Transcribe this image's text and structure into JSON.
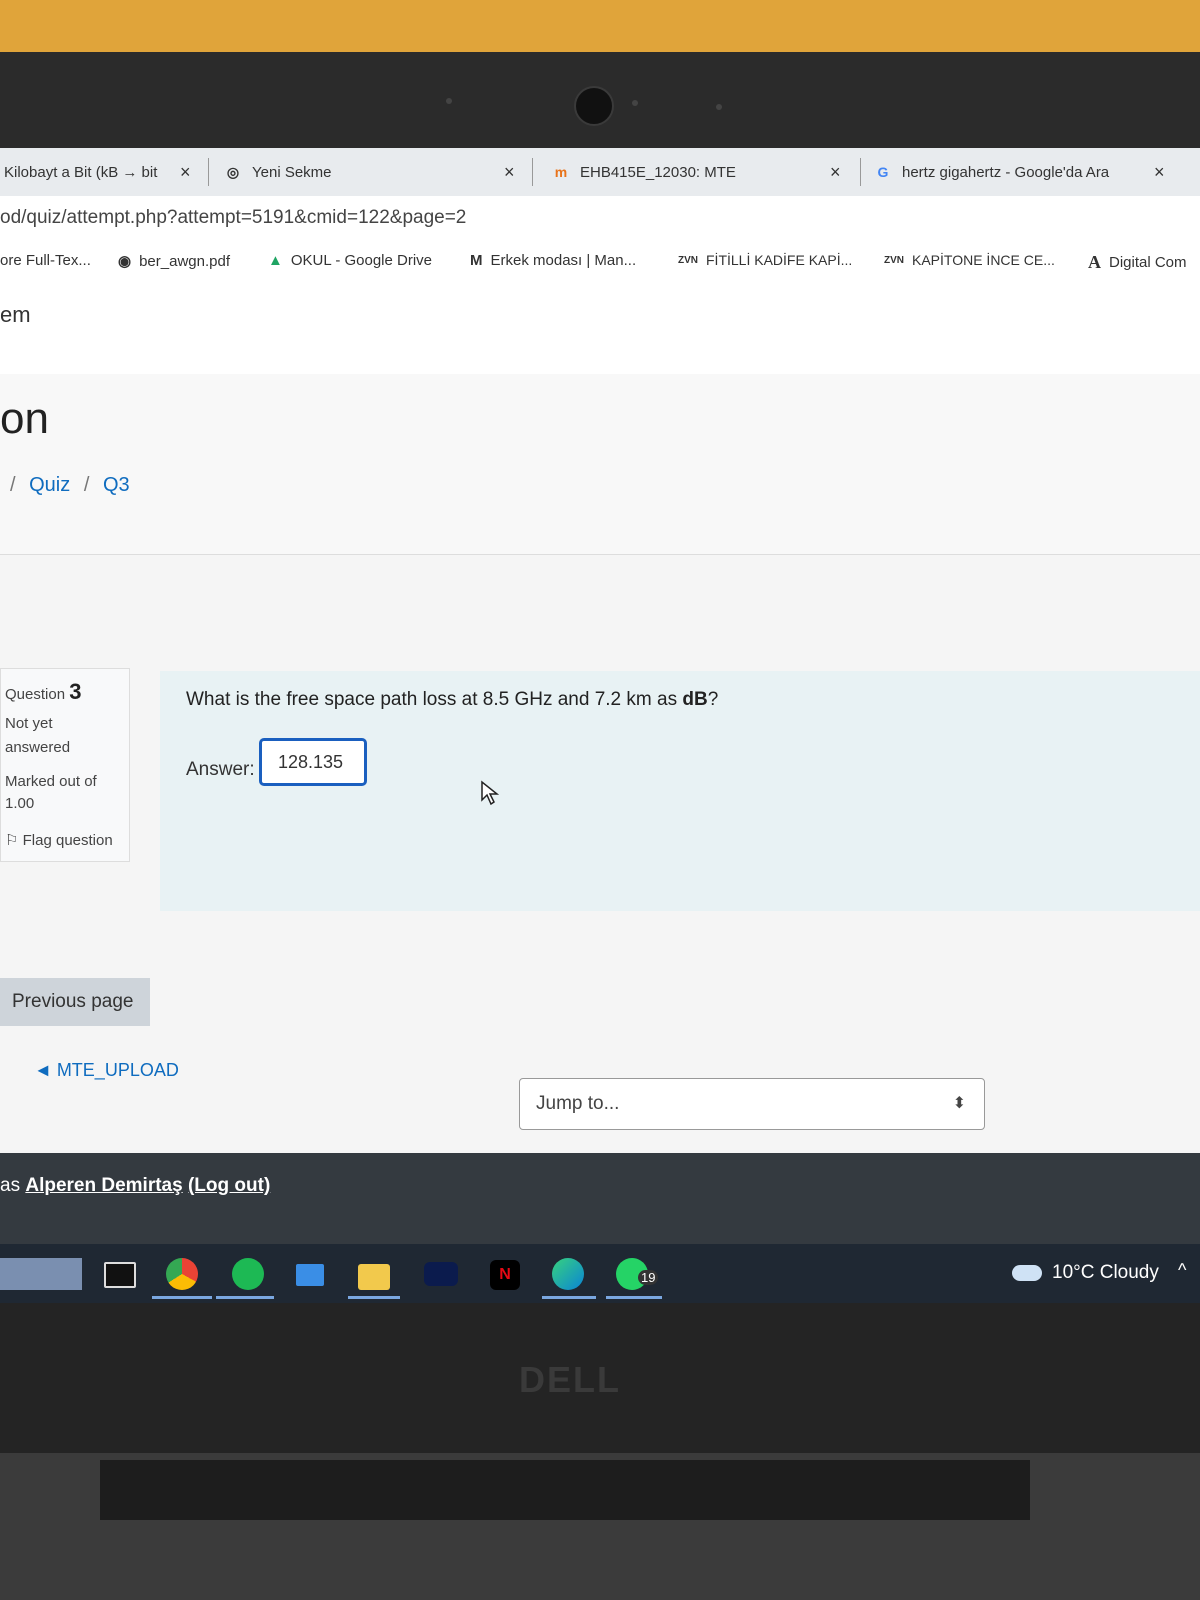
{
  "tabs": [
    {
      "title": "Kilobayt a Bit (kB → bit"
    },
    {
      "title": "Yeni Sekme"
    },
    {
      "title": "EHB415E_12030: MTE"
    },
    {
      "title": "hertz gigahertz - Google'da Ara"
    }
  ],
  "tab_close": "×",
  "address": "od/quiz/attempt.php?attempt=5191&cmid=122&page=2",
  "bookmarks": [
    {
      "icon": "",
      "label": "ore Full-Tex..."
    },
    {
      "icon": "◉",
      "label": "ber_awgn.pdf"
    },
    {
      "icon": "▲",
      "label": "OKUL - Google Drive"
    },
    {
      "icon": "M",
      "label": "Erkek modası | Man..."
    },
    {
      "icon": "ZVN",
      "label": "FİTİLLİ KADİFE KAPİ..."
    },
    {
      "icon": "ZVN",
      "label": "KAPİTONE İNCE CE..."
    },
    {
      "icon": "A",
      "label": "Digital Com"
    }
  ],
  "site_name": "em",
  "page_title": "on",
  "breadcrumb": [
    "/",
    "Quiz",
    "/",
    "Q3"
  ],
  "question_info": {
    "label": "Question",
    "number": "3",
    "status_line1": "Not yet",
    "status_line2": "answered",
    "marked_line1": "Marked out of",
    "marked_line2": "1.00",
    "flag": "Flag question"
  },
  "question": {
    "text_prefix": "What is the free space path loss at 8.5 GHz and 7.2 km as ",
    "text_bold": "dB",
    "text_suffix": "?",
    "answer_label": "Answer:",
    "answer_value": "128.135"
  },
  "nav": {
    "previous_page": "Previous page",
    "prev_activity": "◄ MTE_UPLOAD",
    "jump_to": "Jump to...",
    "jump_caret": "⬍"
  },
  "footer": {
    "prefix": "as ",
    "user": "Alperen Demirtaş",
    "logout": "(Log out)"
  },
  "taskbar": {
    "weather": "10°C  Cloudy",
    "whatsapp_badge": "19",
    "chevron": "^"
  },
  "device_brand": "DELL",
  "colors": {
    "accent": "#0f6cbf",
    "answer_border": "#1a5fbf",
    "card_bg": "#e8f2f4",
    "footer_bg": "#343a40"
  }
}
